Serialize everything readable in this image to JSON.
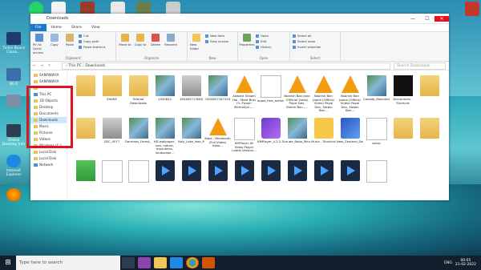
{
  "window": {
    "title": "Downloads",
    "controls": {
      "minimize": "—",
      "maximize": "☐",
      "close": "✕"
    }
  },
  "ribbon": {
    "tabs": [
      "File",
      "Home",
      "Share",
      "View"
    ],
    "groups": [
      {
        "label": "Clipboard",
        "large": [
          "Pin to Quick access",
          "Copy",
          "Paste"
        ],
        "small": [
          "Cut",
          "Copy path",
          "Paste shortcut"
        ]
      },
      {
        "label": "Organize",
        "large": [
          "Move to",
          "Copy to",
          "Delete",
          "Rename"
        ],
        "small": []
      },
      {
        "label": "New",
        "large": [
          "New folder"
        ],
        "small": [
          "New item",
          "Easy access"
        ]
      },
      {
        "label": "Open",
        "large": [
          "Properties"
        ],
        "small": [
          "Open",
          "Edit",
          "History"
        ]
      },
      {
        "label": "Select",
        "large": [],
        "small": [
          "Select all",
          "Select none",
          "Invert selection"
        ]
      }
    ]
  },
  "address": {
    "nav": "← → ↑",
    "path": "› This PC › Downloads",
    "search": "Search Downloads"
  },
  "nav_pane": [
    {
      "label": "SAMANWYA",
      "type": "folder"
    },
    {
      "label": "SAMANWYA",
      "type": "folder"
    },
    {
      "label": "",
      "type": "folder"
    },
    {
      "label": "This PC",
      "type": "pc",
      "selected": false
    },
    {
      "label": "3D Objects",
      "type": "folder"
    },
    {
      "label": "Desktop",
      "type": "folder"
    },
    {
      "label": "Documents",
      "type": "folder"
    },
    {
      "label": "Downloads",
      "type": "folder",
      "selected": true
    },
    {
      "label": "Music",
      "type": "folder"
    },
    {
      "label": "Pictures",
      "type": "folder"
    },
    {
      "label": "Videos",
      "type": "folder"
    },
    {
      "label": "Windows (C:)",
      "type": "drive"
    },
    {
      "label": "Local Disk",
      "type": "drive"
    },
    {
      "label": "Local Disk",
      "type": "drive"
    },
    {
      "label": "Network",
      "type": "pc"
    }
  ],
  "files": [
    {
      "name": "",
      "kind": "folder"
    },
    {
      "name": "SHARE",
      "kind": "folder"
    },
    {
      "name": "Telerad Downloads",
      "kind": "folder"
    },
    {
      "name": "1543822",
      "kind": "img"
    },
    {
      "name": "163482713089",
      "kind": "photo"
    },
    {
      "name": "1634827347254",
      "kind": "img"
    },
    {
      "name": "Aawara Shaam Hai - Meet Bros Ft. Piyush Mehroliya -...",
      "kind": "vlc"
    },
    {
      "name": "avast_free_antivirus_setup_online",
      "kind": "doc"
    },
    {
      "name": "Baarish Ban Jana (Official Video) Payal Dev, Stebin Ben -...",
      "kind": "vlc"
    },
    {
      "name": "Baarish Ban Jaana (Official Video) Payal Dev, Stebin Ben...",
      "kind": "vlc"
    },
    {
      "name": "Baarish Ban Jaana (Official Video) Payal Dev, Stebin Ben...",
      "kind": "vlc"
    },
    {
      "name": "Canada_Mountains_Lake_Snow_Forest_Scenery_3840x2160",
      "kind": "img"
    },
    {
      "name": "Documents - Shortcut",
      "kind": "dark"
    },
    {
      "name": "",
      "kind": "folder"
    },
    {
      "name": "",
      "kind": "folder"
    },
    {
      "name": "DSC_0077",
      "kind": "photo"
    },
    {
      "name": "Dormans_Forest_Lake_Village_UHD_3840x2160",
      "kind": "img"
    },
    {
      "name": "HD wallpaper_ sea, nature, mountains, landscape...",
      "kind": "img"
    },
    {
      "name": "Italy_Lake_Iseo_Mountains_Night_Sky_1920x1200",
      "kind": "img"
    },
    {
      "name": "Kaka - Bholenath (Full Video) Kaka...",
      "kind": "vlc"
    },
    {
      "name": "KMPlayer All Video Player Latest Version...",
      "kind": "doc"
    },
    {
      "name": "KMPlayer_4.2.2.5",
      "kind": "purple"
    },
    {
      "name": "Leude_Baba_Mountain_Lake_HD...",
      "kind": "img"
    },
    {
      "name": "Music - Shortcut",
      "kind": "music"
    },
    {
      "name": "New_Zealand_Sea_Cathedral_Cove_HD_3840x2160",
      "kind": "blue"
    },
    {
      "name": "setup",
      "kind": "doc"
    },
    {
      "name": "",
      "kind": "folder"
    },
    {
      "name": "",
      "kind": "folder"
    },
    {
      "name": "",
      "kind": "green"
    },
    {
      "name": "",
      "kind": "doc"
    },
    {
      "name": "",
      "kind": "doc"
    },
    {
      "name": "",
      "kind": "video"
    },
    {
      "name": "",
      "kind": "video"
    },
    {
      "name": "",
      "kind": "video"
    },
    {
      "name": "",
      "kind": "video"
    },
    {
      "name": "",
      "kind": "video"
    },
    {
      "name": "",
      "kind": "video"
    },
    {
      "name": "",
      "kind": "video"
    },
    {
      "name": "",
      "kind": "video"
    },
    {
      "name": "",
      "kind": "doc"
    }
  ],
  "desktop_icons": [
    {
      "label": "Tickle Board Classi...",
      "icon": "app-icon"
    },
    {
      "label": "Wi-Fi",
      "icon": "wifi-icon"
    },
    {
      "label": "",
      "icon": "folder-icon"
    },
    {
      "label": "Global Desktop Info",
      "icon": "monitor-icon"
    },
    {
      "label": "Internet Explorer",
      "icon": "ie-icon"
    },
    {
      "label": "",
      "icon": "firefox-icon"
    }
  ],
  "taskbar": {
    "start_icon": "⊞",
    "search_placeholder": "Type here to search",
    "time": "00:05",
    "date": "21-02-2022",
    "lang": "ENG"
  }
}
